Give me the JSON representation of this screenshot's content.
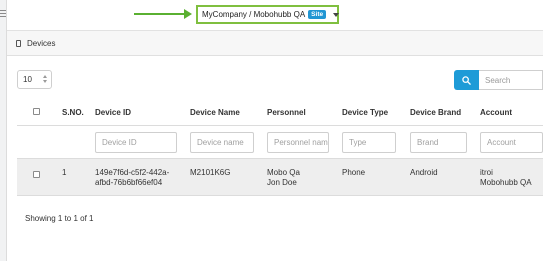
{
  "topbar": {
    "company": "MyCompany / Mobohubb QA",
    "badge": "Site"
  },
  "panel": {
    "title": "Devices"
  },
  "table_controls": {
    "page_length": "10",
    "search_placeholder": "Search"
  },
  "columns": {
    "sno": "S.NO.",
    "device_id": "Device ID",
    "device_name": "Device Name",
    "personnel": "Personnel",
    "device_type": "Device Type",
    "device_brand": "Device Brand",
    "account": "Account"
  },
  "filters": {
    "device_id": "Device ID",
    "device_name": "Device name",
    "personnel": "Personnel name",
    "device_type": "Type",
    "device_brand": "Brand",
    "account": "Account"
  },
  "rows": [
    {
      "sno": "1",
      "device_id_line1": "149e7f6d-c5f2-442a-",
      "device_id_line2": "afbd-76b6bf66ef04",
      "device_name": "M2101K6G",
      "personnel_line1": "Mobo Qa",
      "personnel_line2": "Jon Doe",
      "device_type": "Phone",
      "device_brand": "Android",
      "account_line1": "itroi",
      "account_line2": "Mobohubb QA"
    }
  ],
  "footer": {
    "info": "Showing 1 to 1 of 1"
  },
  "colors": {
    "accent": "#1e9bd7",
    "highlight_border": "#7fbf3f",
    "arrow": "#5ab031"
  }
}
